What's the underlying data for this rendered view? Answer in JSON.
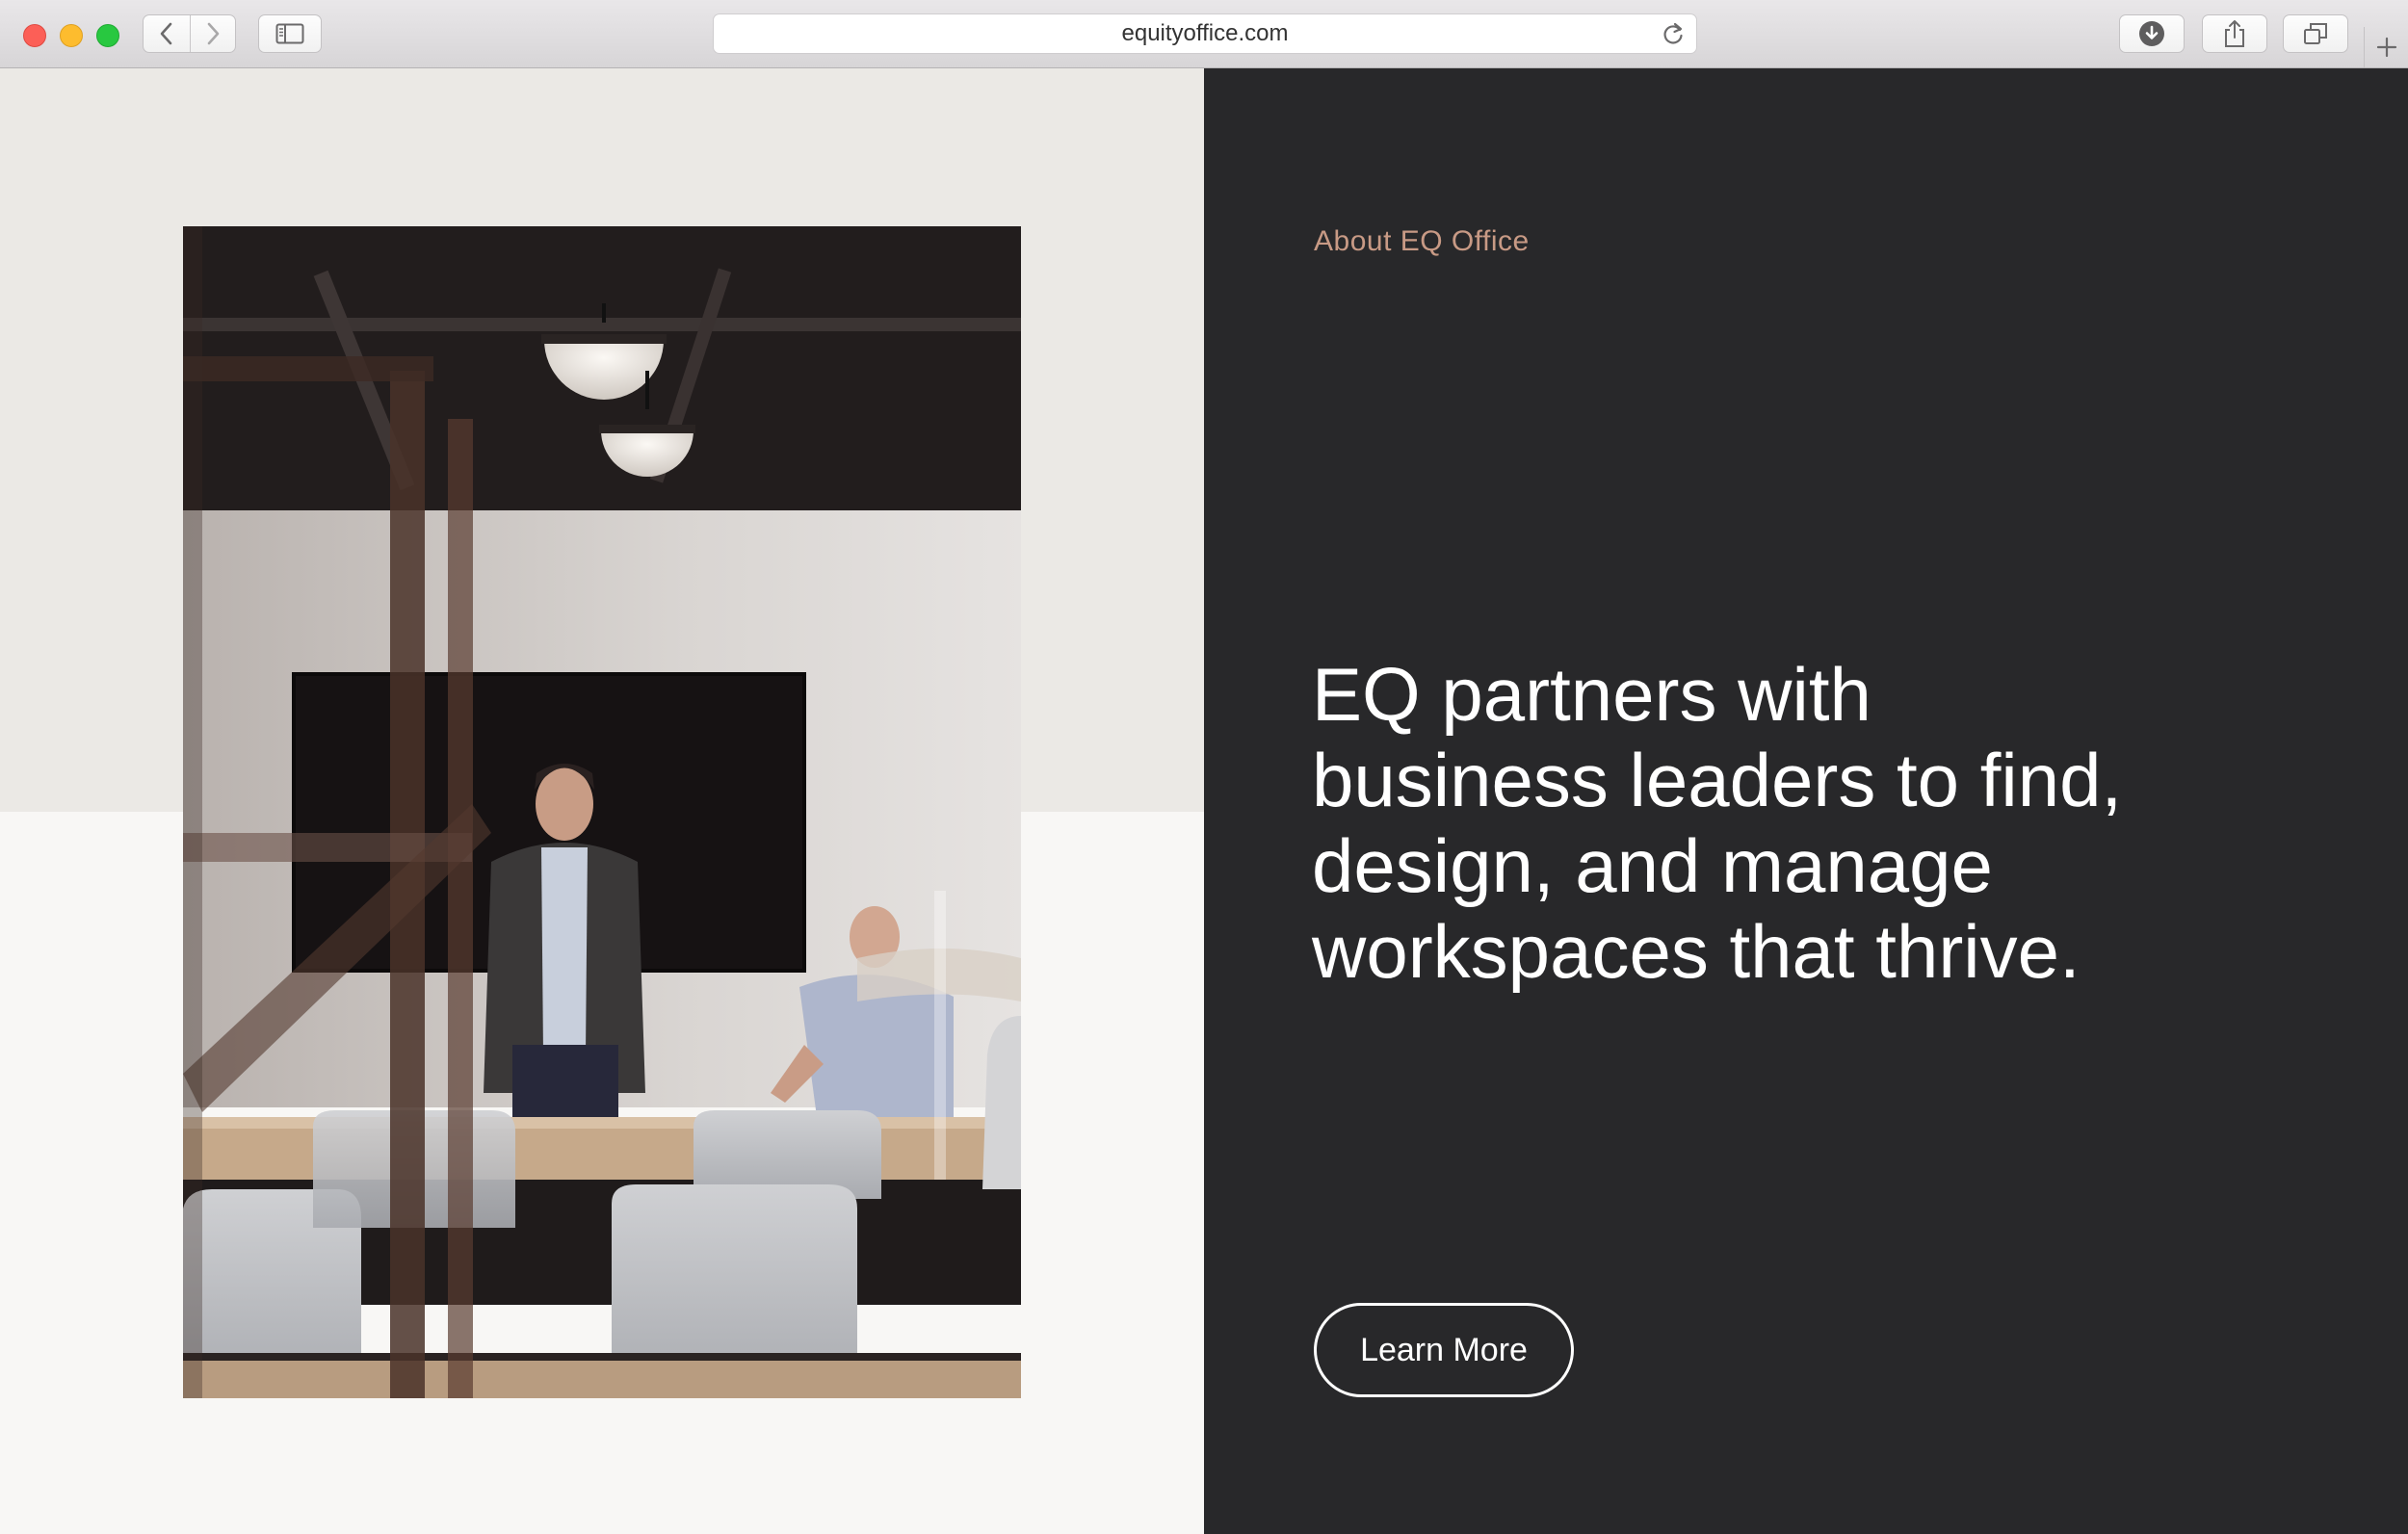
{
  "browser": {
    "url": "equityoffice.com"
  },
  "about": {
    "eyebrow": "About EQ Office",
    "headline": "EQ partners with business leaders to find, design, and manage workspaces that thrive.",
    "cta_label": "Learn More"
  },
  "icons": {
    "back": "chevron-left-icon",
    "forward": "chevron-right-icon",
    "sidebar": "sidebar-icon",
    "reload": "reload-icon",
    "download": "download-icon",
    "share": "share-icon",
    "tabs": "tabs-icon",
    "new_tab": "plus-icon"
  },
  "colors": {
    "dark_panel": "#28282a",
    "accent": "#c89a85",
    "light_panel": "#ebe9e5"
  }
}
